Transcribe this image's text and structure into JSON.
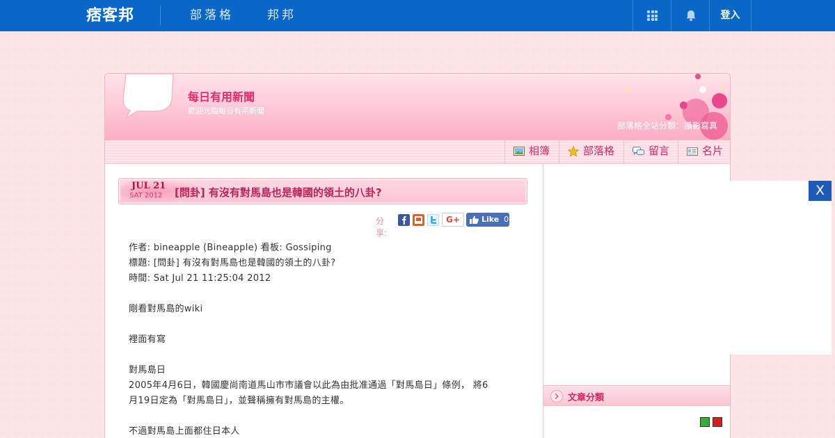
{
  "topbar": {
    "logo": "痞客邦",
    "nav": [
      "部落格",
      "邦邦"
    ],
    "login": "登入"
  },
  "blog": {
    "title": "每日有用新聞",
    "description": "歡迎光臨每日有用新聞",
    "category": "部落格全站分類：攝影寫真"
  },
  "tabs": [
    {
      "label": "相簿",
      "icon": "album-icon"
    },
    {
      "label": "部落格",
      "icon": "star-icon"
    },
    {
      "label": "留言",
      "icon": "message-icon"
    },
    {
      "label": "名片",
      "icon": "card-icon"
    }
  ],
  "post": {
    "month": "JUL 21",
    "day": "SAT 2012",
    "title": "[問卦] 有沒有對馬島也是韓國的領土的八卦?",
    "share_label": "分享:",
    "gplus": "G+",
    "like_label": "Like",
    "like_count": "0",
    "body": [
      "作者: bineapple (Bineapple) 看板: Gossiping",
      "標題: [問卦] 有沒有對馬島也是韓國的領土的八卦?",
      "時間: Sat Jul 21 11:25:04 2012",
      "",
      "剛看對馬島的wiki",
      "",
      "裡面有寫",
      "",
      "對馬島日",
      "2005年4月6日，韓國慶尚南道馬山市市議會以此為由批准通過「對馬島日」條例， 將6",
      "月19日定為「對馬島日」，並聲稱擁有對馬島的主權。",
      "",
      "不過對馬島上面都住日本人"
    ]
  },
  "sidebar": {
    "category_label": "文章分類"
  },
  "ad": {
    "close": "X"
  }
}
